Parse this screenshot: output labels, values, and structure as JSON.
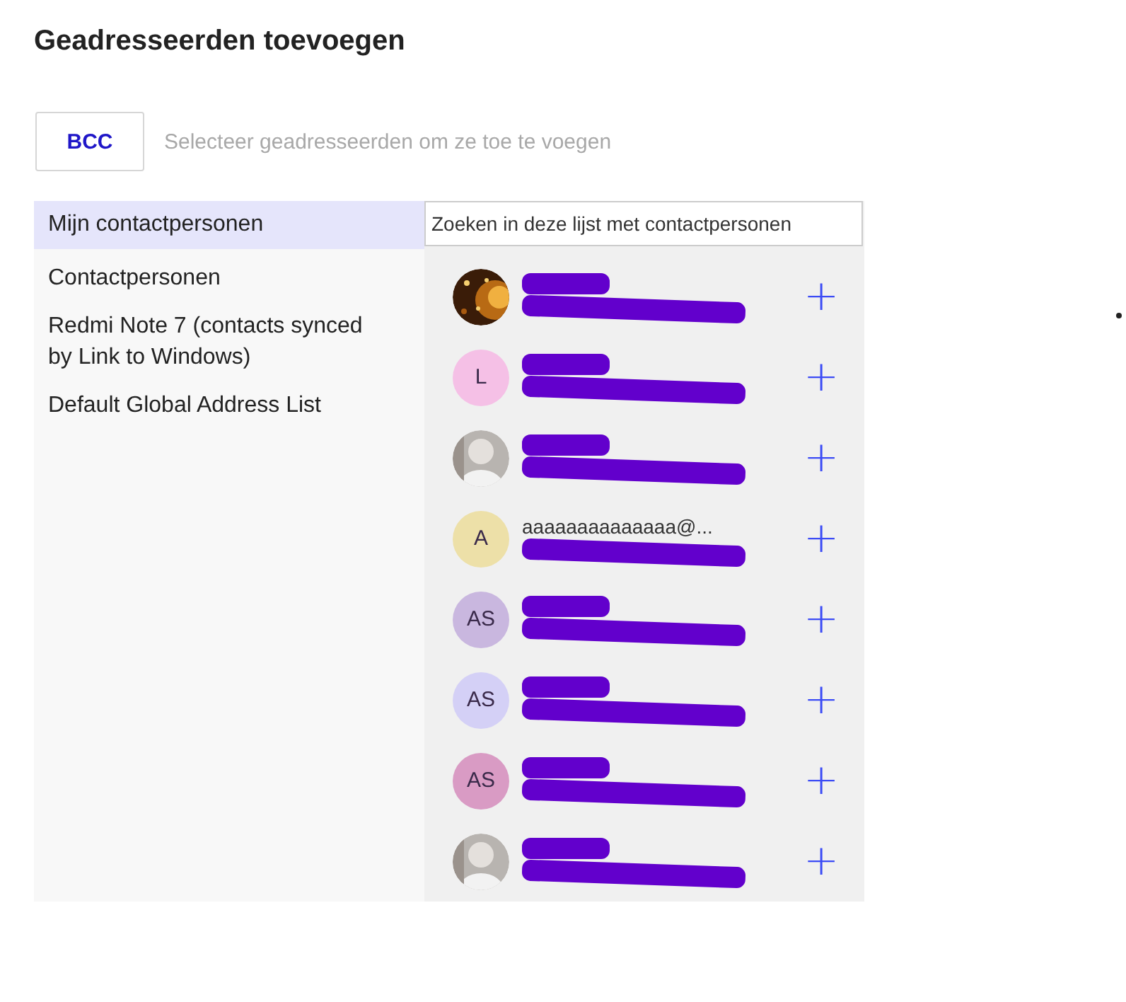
{
  "title": "Geadresseerden toevoegen",
  "recipient_field": {
    "button": "BCC",
    "placeholder": "Selecteer geadresseerden om ze toe te voegen"
  },
  "sources": [
    {
      "label": "Mijn contactpersonen",
      "selected": true
    },
    {
      "label": "Contactpersonen",
      "selected": false
    },
    {
      "label": "Redmi Note 7 (contacts synced by Link to Windows)",
      "selected": false
    },
    {
      "label": "Default Global Address List",
      "selected": false
    }
  ],
  "search": {
    "placeholder": "Zoeken in deze lijst met contactpersonen"
  },
  "contacts": [
    {
      "name_redacted": true,
      "email_redacted": true,
      "add": "+"
    },
    {
      "avatar": {
        "kind": "initials",
        "initials": "L",
        "color": "#f5c0e6"
      },
      "name_redacted": true,
      "email_redacted": true,
      "add": "+"
    },
    {
      "name_redacted": true,
      "email_redacted": true,
      "add": "+"
    },
    {
      "avatar": {
        "kind": "initials",
        "initials": "A",
        "color": "#ede0a8"
      },
      "name": "aaaaaaaaaaaaaa@...",
      "name_redacted": false,
      "email_redacted": true,
      "add": "+"
    },
    {
      "avatar": {
        "kind": "initials",
        "initials": "AS",
        "color": "#c9b7df"
      },
      "name_redacted": true,
      "email_redacted": true,
      "add": "+"
    },
    {
      "avatar": {
        "kind": "initials",
        "initials": "AS",
        "color": "#d4d0f6"
      },
      "name_redacted": true,
      "email_redacted": true,
      "add": "+"
    },
    {
      "avatar": {
        "kind": "initials",
        "initials": "AS",
        "color": "#d99bc4"
      },
      "name_redacted": true,
      "email_redacted": true,
      "add": "+"
    },
    {
      "name_redacted": true,
      "email_redacted": true,
      "add": "+"
    }
  ]
}
